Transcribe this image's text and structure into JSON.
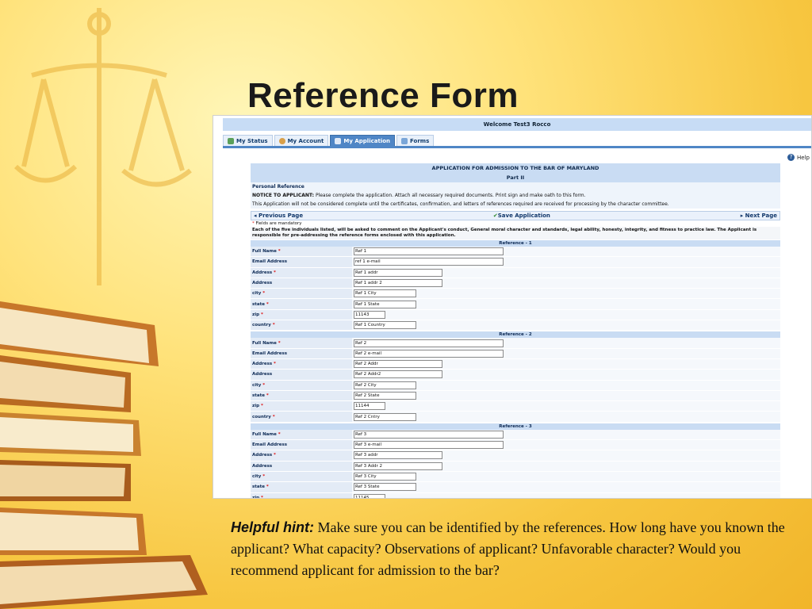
{
  "slide": {
    "title": "Reference Form",
    "hint_label": "Helpful hint:",
    "hint_text": " Make sure you can be identified by the references. How long have you known the applicant? What capacity? Observations of applicant? Unfavorable character?  Would you recommend applicant for admission to the bar?"
  },
  "app": {
    "welcome": "Welcome Test3 Rocco",
    "tabs": [
      {
        "label": "My Status",
        "icon": "status-icon"
      },
      {
        "label": "My Account",
        "icon": "account-icon"
      },
      {
        "label": "My Application",
        "icon": "application-icon",
        "active": true
      },
      {
        "label": "Forms",
        "icon": "forms-icon"
      }
    ],
    "help": "Help",
    "header1": "APPLICATION FOR ADMISSION TO THE BAR OF MARYLAND",
    "header2": "Part II",
    "section_title": "Personal Reference",
    "notice_label": "NOTICE TO APPLICANT:",
    "notice_text": " Please complete the application. Attach all necessary required documents. Print sign and make oath to this form.",
    "notice2": "This Application will not be considered complete until the certificates, confirmation, and letters of references required are received for processing by the character committee.",
    "nav": {
      "prev": "Previous Page",
      "save": "Save Application",
      "next": "Next Page"
    },
    "mandatory": "Fields are mandatory",
    "mandatory_star": "*",
    "intro": "Each of the five individuals listed, will be asked to comment on the Applicant's conduct, General moral character and standards, legal ability, honesty, integrity, and fitness to practice law. The Applicant is responsible for pre-addressing the reference forms enclosed with this application.",
    "labels": {
      "full_name": "Full Name",
      "email": "Email Address",
      "address": "Address",
      "address2": "Address",
      "city": "city",
      "state": "state",
      "zip": "zip",
      "country": "country",
      "star": "*"
    },
    "ref1": {
      "heading": "Reference - 1",
      "full_name": "Ref 1",
      "email": "ref 1 e-mail",
      "address": "Ref 1 addr",
      "address2": "Ref 1 addr 2",
      "city": "Ref 1 City",
      "state": "Ref 1 State",
      "zip": "11143",
      "country": "Ref 1 Country"
    },
    "ref2": {
      "heading": "Reference - 2",
      "full_name": "Ref 2",
      "email": "Ref 2 e-mail",
      "address": "Ref 2 Addr",
      "address2": "Ref 2 Addr2",
      "city": "Ref 2 City",
      "state": "Ref 2 State",
      "zip": "11144",
      "country": "Ref 2 Cntry"
    },
    "ref3": {
      "heading": "Reference - 3",
      "full_name": "Ref 3",
      "email": "Ref 3 e-mail",
      "address": "Ref 3 addr",
      "address2": "Ref 3 Addr 2",
      "city": "Ref 3 City",
      "state": "Ref 3 State",
      "zip": "11145"
    }
  },
  "colors": {
    "accent": "#4f86c6",
    "header_bg": "#c9dcf3",
    "background": "#f7c640"
  }
}
